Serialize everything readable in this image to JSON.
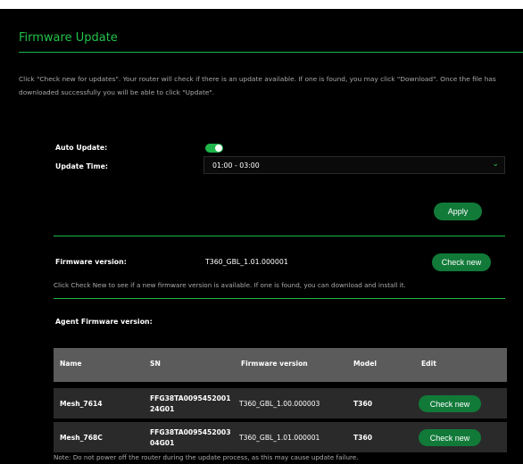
{
  "title": "Firmware Update",
  "description": {
    "line1": "Click \"Check new for updates\". Your router will check if there is an update available. If one is found, you may click \"Download\". Once the file has",
    "line2": "downloaded successfully you will be able to click \"Update\"."
  },
  "auto_update": {
    "label": "Auto Update:",
    "enabled": true
  },
  "update_time": {
    "label": "Update Time:",
    "value": "01:00 - 03:00"
  },
  "apply_label": "Apply",
  "firmware": {
    "label": "Firmware version:",
    "value": "T360_GBL_1.01.000001",
    "button": "Check new",
    "hint": "Click Check New to see if a new firmware version is available. If one is found, you can download and install it."
  },
  "agent": {
    "label": "Agent Firmware version:",
    "columns": [
      "Name",
      "SN",
      "Firmware version",
      "Model",
      "Edit"
    ],
    "rows": [
      {
        "name": "Mesh_7614",
        "sn_line1": "FFG38TA0095452001",
        "sn_line2": "24G01",
        "firmware": "T360_GBL_1.00.000003",
        "model": "T360",
        "button": "Check new"
      },
      {
        "name": "Mesh_768C",
        "sn_line1": "FFG38TA0095452003",
        "sn_line2": "04G01",
        "firmware": "T360_GBL_1.01.000001",
        "model": "T360",
        "button": "Check new"
      }
    ]
  },
  "note": "Note: Do not power off the router during the update process, as this may cause update failure.",
  "colors": {
    "accent": "#22c24a",
    "button": "#117a39",
    "background": "#000000"
  }
}
